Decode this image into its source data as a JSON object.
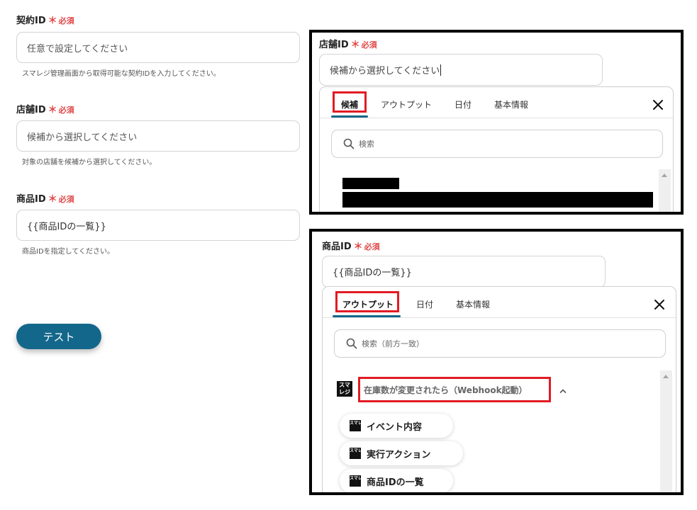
{
  "form": {
    "contract_id": {
      "label": "契約ID",
      "required_mark": "＊",
      "required_text": "必須",
      "placeholder": "任意で設定してください",
      "hint": "スマレジ管理画面から取得可能な契約IDを入力してください。"
    },
    "store_id": {
      "label": "店舗ID",
      "required_mark": "＊",
      "required_text": "必須",
      "placeholder": "候補から選択してください",
      "hint": "対象の店舗を候補から選択してください。"
    },
    "product_id": {
      "label": "商品ID",
      "required_mark": "＊",
      "required_text": "必須",
      "value": "{{商品IDの一覧}}",
      "hint": "商品IDを指定してください。"
    },
    "test_button": "テスト"
  },
  "store_panel": {
    "label": "店舗ID",
    "required_mark": "＊",
    "required_text": "必須",
    "input_value": "候補から選択してください",
    "tabs": [
      "候補",
      "アウトプット",
      "日付",
      "基本情報"
    ],
    "active_tab": "候補",
    "search_placeholder": "検索"
  },
  "product_panel": {
    "label": "商品ID",
    "required_mark": "＊",
    "required_text": "必須",
    "input_value": "{{商品IDの一覧}}",
    "tabs": [
      "アウトプット",
      "日付",
      "基本情報"
    ],
    "active_tab": "アウトプット",
    "search_placeholder": "検索（前方一致）",
    "group_title": "在庫数が変更されたら（Webhook起動）",
    "app_logo_text": "スマレジ",
    "items": [
      "イベント内容",
      "実行アクション",
      "商品IDの一覧"
    ]
  },
  "colors": {
    "accent": "#13678a",
    "required": "#e04646",
    "highlight": "#e21b24"
  }
}
